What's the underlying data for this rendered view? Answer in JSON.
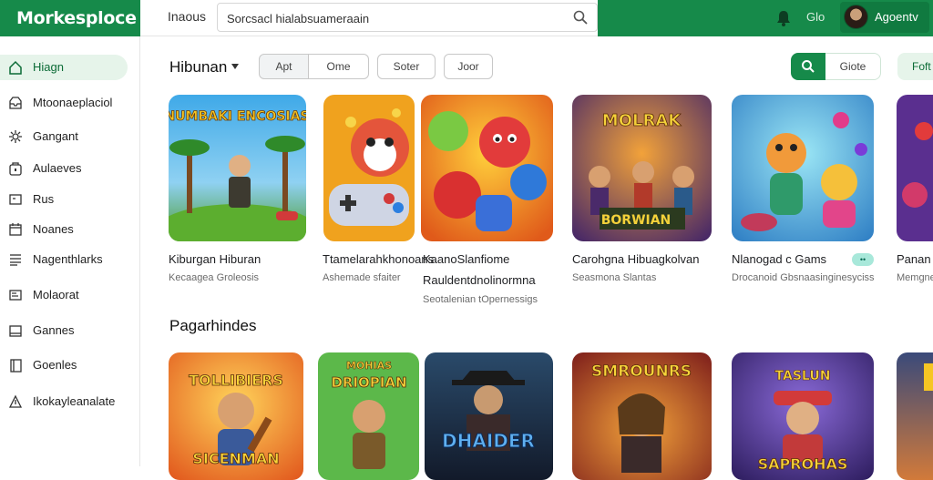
{
  "brand": "Morkesploce",
  "header": {
    "label": "Inaous",
    "search_value": "Sorcsacl hialabsuameraain",
    "right_text": "Glo",
    "user_name": "Agoentv"
  },
  "sidebar": {
    "items": [
      {
        "label": "Hiagn",
        "icon": "home-icon",
        "active": true
      },
      {
        "label": "Mtoonaeplaciol",
        "icon": "inbox-icon"
      },
      {
        "label": "Gangant",
        "icon": "settings-icon"
      },
      {
        "label": "Aulaeves",
        "icon": "bag-icon"
      },
      {
        "label": "Rus",
        "icon": "window-icon"
      },
      {
        "label": "Noanes",
        "icon": "calendar-icon"
      },
      {
        "label": "Nagenthlarks",
        "icon": "list-icon"
      },
      {
        "label": "Molaorat",
        "icon": "card-icon"
      },
      {
        "label": "Gannes",
        "icon": "panel-icon"
      },
      {
        "label": "Goenles",
        "icon": "book-icon"
      },
      {
        "label": "Ikokayleanalate",
        "icon": "triangle-icon"
      }
    ]
  },
  "toolbar": {
    "title": "Hibunan",
    "segments": [
      "Apt",
      "Ome"
    ],
    "buttons": [
      "Soter",
      "Joor"
    ],
    "store_label": "Giote",
    "extra_label": "Foft"
  },
  "row1": {
    "cards": [
      {
        "title": "Kiburgan Hiburan",
        "sub": "Kecaagea Groleosis",
        "art_text": "NUMBAKI ENCOSIAS"
      },
      {
        "title": "Ttamelarahkhonoans",
        "sub": "Ashemade sfaiter"
      },
      {
        "title": "KaanoSlanfiome",
        "title2": "Rauldentdnolinormna",
        "sub": "Seotalenian tOpernessigs"
      },
      {
        "title": "Carohgna Hibuagkolvan",
        "sub": "Seasmona Slantas",
        "art_text": "MOLRAK",
        "art_text2": "BORWIAN"
      },
      {
        "title": "Nlanogad c Gams",
        "sub": "Drocanoid Gbsnaasinginesyciss",
        "badge": "••"
      },
      {
        "title": "Panan",
        "sub": "Memgne"
      }
    ]
  },
  "row2": {
    "title": "Pagarhindes",
    "cards": [
      {
        "art_text": "TOLLIBIERS",
        "art_text2": "SICENMAN"
      },
      {
        "art_text": "MOHIAS",
        "art_text2": "DRIOPIAN"
      },
      {
        "art_text": "DHAIDER"
      },
      {
        "art_text": "SMROUNRS"
      },
      {
        "art_text": "TASLUN",
        "art_text2": "SAPROHAS"
      },
      {
        "art_text": ""
      }
    ]
  },
  "colors": {
    "brand_green": "#168a4a",
    "active_bg": "#e6f4ea"
  }
}
